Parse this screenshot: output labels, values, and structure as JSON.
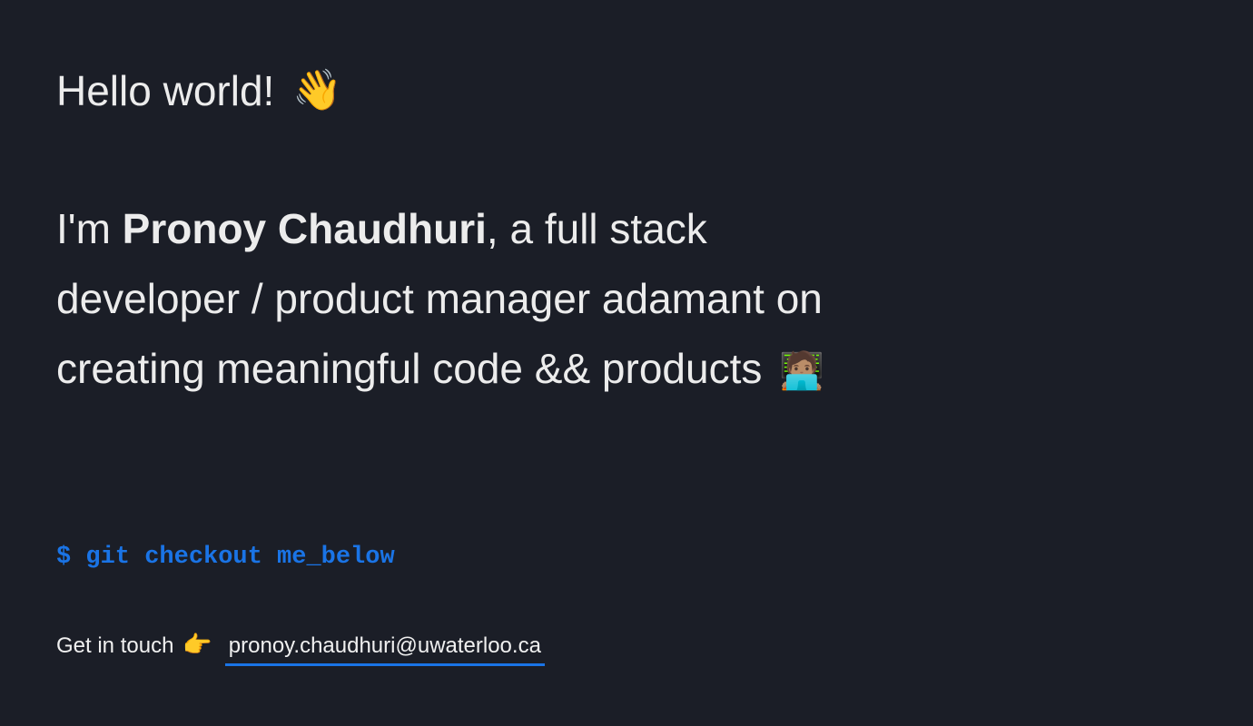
{
  "greeting": {
    "text": "Hello world!",
    "emoji": "👋",
    "emoji_icon": "waving-hand-icon"
  },
  "intro": {
    "prefix": "I'm ",
    "name": "Pronoy Chaudhuri",
    "body": ", a full stack developer / product manager adamant on creating meaningful code && products",
    "emoji": "🧑🏽‍💻",
    "emoji_icon": "technologist-icon"
  },
  "command": {
    "text": "$ git checkout me_below"
  },
  "contact": {
    "label": "Get in touch",
    "emoji": "👉",
    "emoji_icon": "pointing-right-icon",
    "email": "pronoy.chaudhuri@uwaterloo.ca"
  },
  "colors": {
    "background": "#1b1e27",
    "text": "#ececec",
    "accent": "#1a74e6"
  }
}
